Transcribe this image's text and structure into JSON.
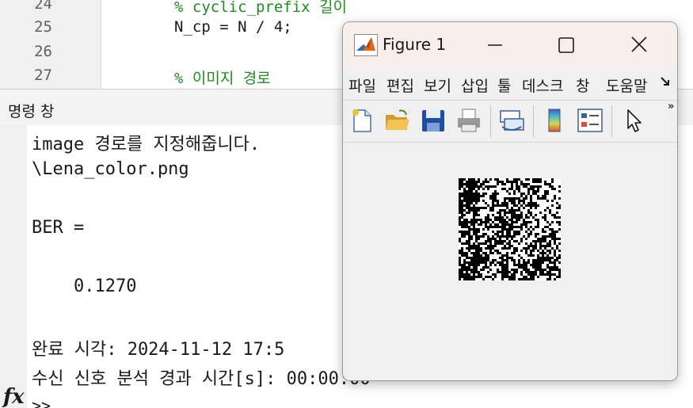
{
  "editor": {
    "lines": [
      {
        "num": "24",
        "code": "% cyclic_prefix 길이",
        "kind": "comment"
      },
      {
        "num": "25",
        "code": "N_cp = N / 4;",
        "kind": "code"
      },
      {
        "num": "26",
        "code": "",
        "kind": "code"
      },
      {
        "num": "27",
        "code": "% 이미지 경로",
        "kind": "comment"
      }
    ]
  },
  "command_window": {
    "title": "명령 창",
    "output": [
      "image 경로를 지정해줍니다.",
      "\\Lena_color.png",
      "",
      "BER =",
      "",
      "    0.1270",
      "",
      "완료 시각: 2024-11-12 17:5",
      "수신 신호 분석 경과 시간[s]: 00:00:00"
    ],
    "prompt": ">>"
  },
  "figure": {
    "title": "Figure 1",
    "menu": [
      "파일",
      "편집",
      "보기",
      "삽입",
      "툴",
      "데스크",
      "창",
      "도움말"
    ],
    "menu_overflow": "»",
    "colors": {
      "titlebar": "#f8efec",
      "body": "#f0f0f0"
    }
  }
}
